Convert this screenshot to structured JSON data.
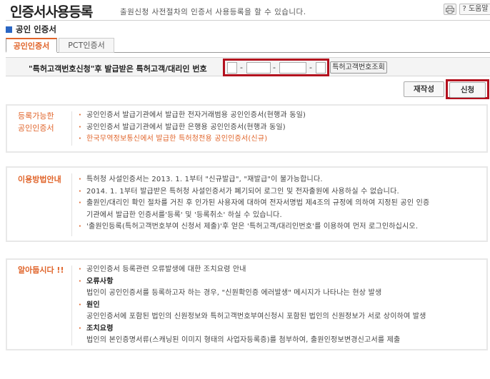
{
  "header": {
    "title": "인증서사용등록",
    "description": "출원신청 사전절차의 인증서 사용등록을 할 수 있습니다.",
    "help_label": "? 도움말"
  },
  "section": {
    "title": "공인 인증서"
  },
  "tabs": [
    {
      "label": "공인인증서",
      "active": true
    },
    {
      "label": "PCT인증서",
      "active": false
    }
  ],
  "form": {
    "label": "\"특허고객번호신청\"후 발급받은 특허고객/대리인 번호",
    "separator": "-",
    "lookup_label": "특허고객번호조회"
  },
  "actions": {
    "rewrite_label": "재작성",
    "apply_label": "신청"
  },
  "boxes": {
    "available": {
      "label_lines": [
        "등록가능한",
        "공인인증서"
      ],
      "items": [
        "공인인증서 발급기관에서 발급한 전자거래범용 공인인증서(현행과 동일)",
        "공인인증서 발급기관에서 발급한 은행용 공인인증서(현행과 동일)",
        "한국무역정보통신에서 발급한 특허청전용 공인인증서(신규)"
      ]
    },
    "usage": {
      "label": "이용방법안내",
      "items": [
        "특허청 사설인증서는 2013. 1. 1부터 \"신규발급\", \"재발급\"이 불가능합니다.",
        "2014. 1. 1부터 발급받은 특허청 사설인증서가 폐기되어 로그인 및 전자출원에 사용하실 수 없습니다.",
        "출원인/대리인 확인 절차를 거친 후 인가된 사용자에 대하여 전자서명법 제4조의 규정에 의하여 지정된 공인 인증",
        "기관에서 발급한 인증서를'등록' 및 '등록취소' 하실 수 있습니다.",
        "'출원인등록(특허고객번호부여 신청서 제출)'후 얻은 '특허고객/대리인번호'를 이용하여 먼저 로그인하십시오."
      ]
    },
    "notice": {
      "label": "알아둡시다 !!",
      "items": [
        "공인인증서 등록관련 오류발생에 대한 조치요령 안내",
        "오류사항",
        "법인이 공인인증서를 등록하고자 하는 경우, \"신원확인증 에러발생\" 메시지가 나타나는 현상 발생",
        "원인",
        "공인인증서에 포함된 법인의 신원정보와 특허고객번호부여신청시 포함된 법인의 신원정보가 서로 상이하여 발생",
        "조치요령",
        "법인의 본인증명서류(스캐닝된 이미지 형태의 사업자등록증)를 첨부하여, 출원인정보변경신고서를 제출"
      ]
    }
  },
  "colors": {
    "accent": "#e0642a",
    "highlight": "#b3101e",
    "bullet_blue": "#2a66c3"
  }
}
